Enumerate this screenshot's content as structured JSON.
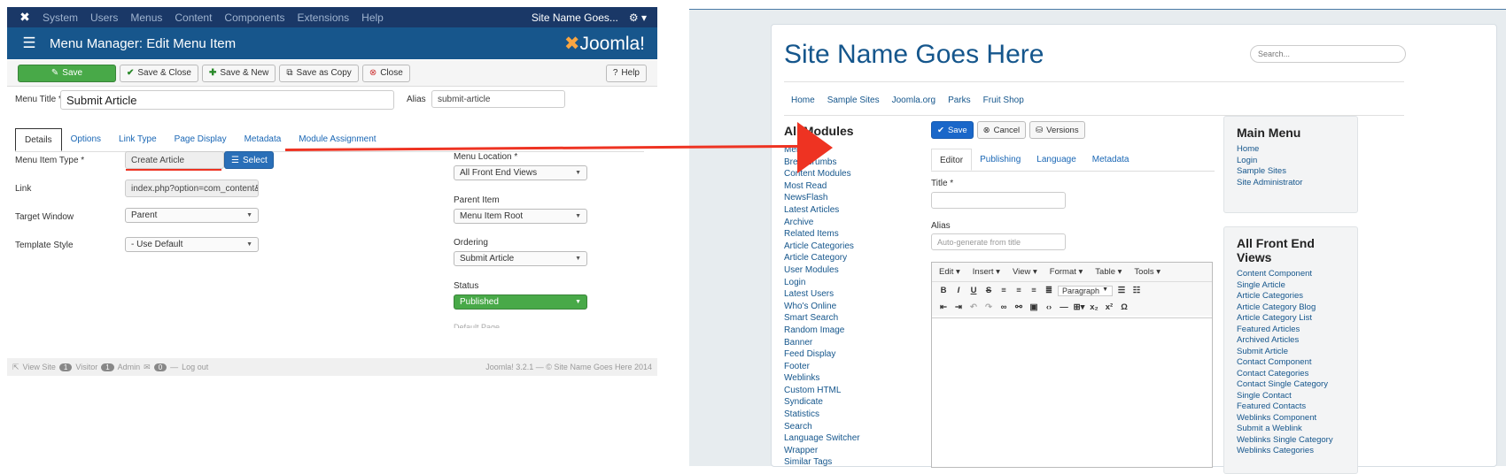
{
  "admin": {
    "topbar": {
      "items": [
        "System",
        "Users",
        "Menus",
        "Content",
        "Components",
        "Extensions",
        "Help"
      ],
      "site": "Site Name Goes..."
    },
    "header": {
      "title": "Menu Manager: Edit Menu Item",
      "brand": "Joomla!"
    },
    "toolbar": {
      "save": "Save",
      "save_close": "Save & Close",
      "save_new": "Save & New",
      "save_copy": "Save as Copy",
      "close": "Close",
      "help": "Help"
    },
    "menu_title_label": "Menu Title *",
    "menu_title_value": "Submit Article",
    "alias_label": "Alias",
    "alias_value": "submit-article",
    "tabs": [
      "Details",
      "Options",
      "Link Type",
      "Page Display",
      "Metadata",
      "Module Assignment"
    ],
    "menu_item_type_label": "Menu Item Type *",
    "menu_item_type_value": "Create Article",
    "select_button": "Select",
    "link_label": "Link",
    "link_value": "index.php?option=com_content&vie",
    "target_window_label": "Target Window",
    "target_window_value": "Parent",
    "template_style_label": "Template Style",
    "template_style_value": "- Use Default",
    "menu_location_label": "Menu Location *",
    "menu_location_value": "All Front End Views",
    "parent_item_label": "Parent Item",
    "parent_item_value": "Menu Item Root",
    "ordering_label": "Ordering",
    "ordering_value": "Submit Article",
    "status_label": "Status",
    "status_value": "Published",
    "default_page_label": "Default Page",
    "footer": {
      "view_site": "View Site",
      "visitor_count": "1",
      "visitor": "Visitor",
      "admin_count": "1",
      "admin": "Admin",
      "mail_count": "0",
      "logout": "Log out",
      "version": "Joomla! 3.2.1 — © Site Name Goes Here 2014"
    }
  },
  "site": {
    "title": "Site Name Goes Here",
    "search_placeholder": "Search...",
    "nav": [
      "Home",
      "Sample Sites",
      "Joomla.org",
      "Parks",
      "Fruit Shop"
    ],
    "all_modules_heading": "All Modules",
    "modules": [
      "Menu",
      "Breadcrumbs",
      "Content Modules",
      "Most Read",
      "NewsFlash",
      "Latest Articles",
      "Archive",
      "Related Items",
      "Article Categories",
      "Article Category",
      "User Modules",
      "Login",
      "Latest Users",
      "Who's Online",
      "Smart Search",
      "Random Image",
      "Banner",
      "Feed Display",
      "Footer",
      "Weblinks",
      "Custom HTML",
      "Syndicate",
      "Statistics",
      "Search",
      "Language Switcher",
      "Wrapper",
      "Similar Tags"
    ],
    "editor_buttons": {
      "save": "Save",
      "cancel": "Cancel",
      "versions": "Versions"
    },
    "editor_tabs": [
      "Editor",
      "Publishing",
      "Language",
      "Metadata"
    ],
    "title_label": "Title *",
    "alias_label": "Alias",
    "alias_placeholder": "Auto-generate from title",
    "mce_menu": [
      "Edit ▾",
      "Insert ▾",
      "View ▾",
      "Format ▾",
      "Table ▾",
      "Tools ▾"
    ],
    "mce_paragraph": "Paragraph",
    "main_menu": {
      "heading": "Main Menu",
      "items": [
        "Home",
        "Login",
        "Sample Sites",
        "Site Administrator"
      ]
    },
    "front_end": {
      "heading": "All Front End Views",
      "items": [
        "Content Component",
        "Single Article",
        "Article Categories",
        "Article Category Blog",
        "Article Category List",
        "Featured Articles",
        "Archived Articles",
        "Submit Article",
        "Contact Component",
        "Contact Categories",
        "Contact Single Category",
        "Single Contact",
        "Featured Contacts",
        "Weblinks Component",
        "Submit a Weblink",
        "Weblinks Single Category",
        "Weblinks Categories"
      ]
    }
  },
  "colors": {
    "accent_red": "#e33322",
    "admin_blue": "#17568c",
    "save_green": "#48a948"
  }
}
